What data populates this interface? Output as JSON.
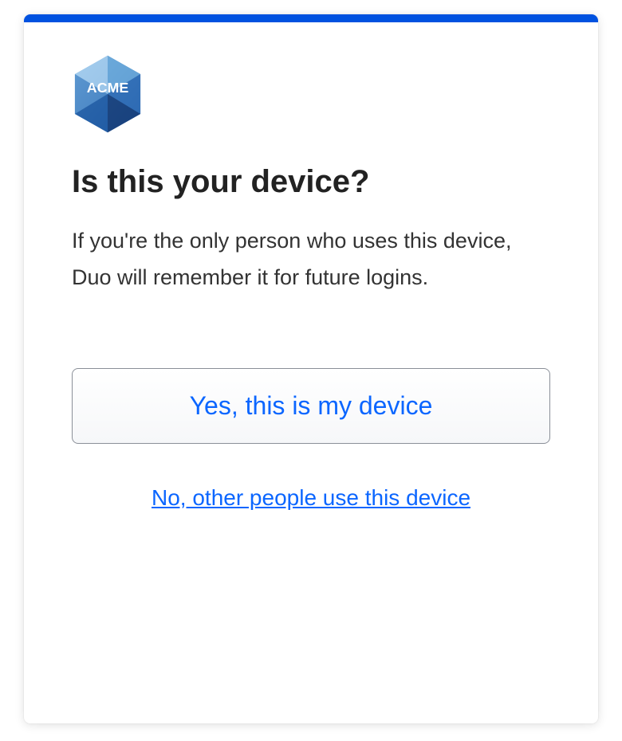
{
  "brand": {
    "logo_text": "ACME",
    "accent_color": "#0052e0",
    "link_color": "#0b66ff"
  },
  "prompt": {
    "heading": "Is this your device?",
    "body": "If you're the only person who uses this device, Duo will remember it for future logins."
  },
  "actions": {
    "primary_label": "Yes, this is my device",
    "secondary_label": "No, other people use this device"
  }
}
